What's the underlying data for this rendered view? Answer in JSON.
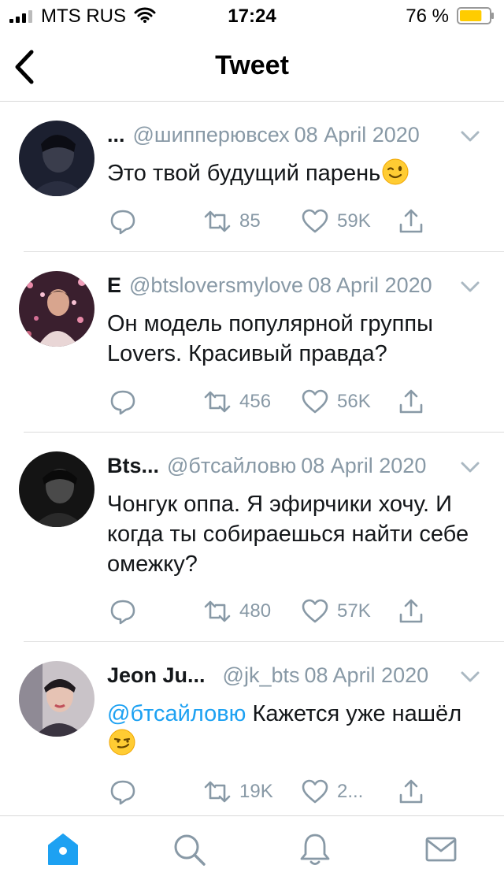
{
  "status_bar": {
    "carrier": "MTS RUS",
    "time": "17:24",
    "battery_percent": "76 %",
    "battery_level": 0.76,
    "battery_color": "#ffcc00"
  },
  "header": {
    "title": "Tweet",
    "back_icon": "chevron-left-icon"
  },
  "tweets": [
    {
      "name": "...",
      "handle": "@шипперювсех",
      "date": "08 April 2020",
      "text": "Это твой будущий парень",
      "emoji": "winking-face",
      "replies": "",
      "retweets": "85",
      "likes": "59K"
    },
    {
      "name": "E",
      "handle": "@btsloversmylove",
      "date": "08 April 2020",
      "text": "Он модель популярной группы Lovers. Красивый правда?",
      "replies": "",
      "retweets": "456",
      "likes": "56K"
    },
    {
      "name": "Bts...",
      "handle": "@бтсайловю",
      "date": "08 April 2020",
      "text": "Чонгук оппа. Я эфирчики хочу. И когда ты собираешься найти себе омежку?",
      "replies": "",
      "retweets": "480",
      "likes": "57K"
    },
    {
      "name": "Jeon Ju...",
      "handle": "@jk_bts",
      "date": "08 April 2020",
      "mention": "@бтсайловю",
      "text": "Кажется уже нашёл",
      "emoji": "smirking-face",
      "replies": "",
      "retweets": "19K",
      "likes": "2..."
    }
  ],
  "tab_bar": {
    "tabs": [
      "home-icon",
      "search-icon",
      "notifications-bell-icon",
      "messages-envelope-icon"
    ],
    "active_tab": "home",
    "active_color": "#1da1f2",
    "inactive_color": "#8899a6"
  },
  "colors": {
    "accent": "#1da1f2",
    "secondary_text": "#8899a6"
  }
}
